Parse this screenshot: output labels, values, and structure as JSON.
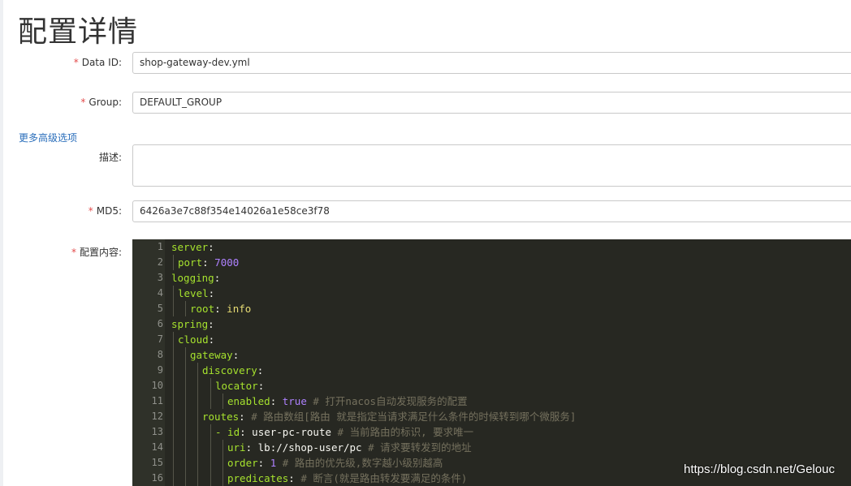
{
  "page": {
    "title": "配置详情"
  },
  "form": {
    "data_id": {
      "label": "Data ID:",
      "value": "shop-gateway-dev.yml",
      "required_mark": "*"
    },
    "group": {
      "label": "Group:",
      "value": "DEFAULT_GROUP",
      "required_mark": "*"
    },
    "advanced_link": "更多高级选项",
    "description": {
      "label": "描述:",
      "value": ""
    },
    "md5": {
      "label": "MD5:",
      "value": "6426a3e7c88f354e14026a1e58ce3f78",
      "required_mark": "*"
    },
    "content": {
      "label": "配置内容:",
      "required_mark": "*"
    }
  },
  "editor": {
    "line_numbers": [
      "1",
      "2",
      "3",
      "4",
      "5",
      "6",
      "7",
      "8",
      "9",
      "10",
      "11",
      "12",
      "13",
      "14",
      "15",
      "16"
    ],
    "lines": [
      {
        "key": "server",
        "sep": ":",
        "value": "",
        "comment": ""
      },
      {
        "key": "port",
        "sep": ": ",
        "value": "7000",
        "comment": ""
      },
      {
        "key": "logging",
        "sep": ":",
        "value": "",
        "comment": ""
      },
      {
        "key": "level",
        "sep": ":",
        "value": "",
        "comment": ""
      },
      {
        "key": "root",
        "sep": ": ",
        "value": "info",
        "comment": ""
      },
      {
        "key": "spring",
        "sep": ":",
        "value": "",
        "comment": ""
      },
      {
        "key": "cloud",
        "sep": ":",
        "value": "",
        "comment": ""
      },
      {
        "key": "gateway",
        "sep": ":",
        "value": "",
        "comment": ""
      },
      {
        "key": "discovery",
        "sep": ":",
        "value": "",
        "comment": ""
      },
      {
        "key": "locator",
        "sep": ":",
        "value": "",
        "comment": ""
      },
      {
        "key": "enabled",
        "sep": ": ",
        "value": "true",
        "comment": " # 打开nacos自动发现服务的配置"
      },
      {
        "key": "routes",
        "sep": ": ",
        "value": "",
        "comment": "# 路由数组[路由 就是指定当请求满足什么条件的时候转到哪个微服务]"
      },
      {
        "key": "- id",
        "sep": ": ",
        "value": "user-pc-route",
        "comment": " # 当前路由的标识, 要求唯一"
      },
      {
        "key": "uri",
        "sep": ": ",
        "value": "lb://shop-user/pc",
        "comment": " # 请求要转发到的地址"
      },
      {
        "key": "order",
        "sep": ": ",
        "value": "1",
        "comment": " # 路由的优先级,数字越小级别越高"
      },
      {
        "key": "predicates",
        "sep": ": ",
        "value": "",
        "comment": "# 断言(就是路由转发要满足的条件)"
      }
    ]
  },
  "watermark": "https://blog.csdn.net/Gelouc"
}
